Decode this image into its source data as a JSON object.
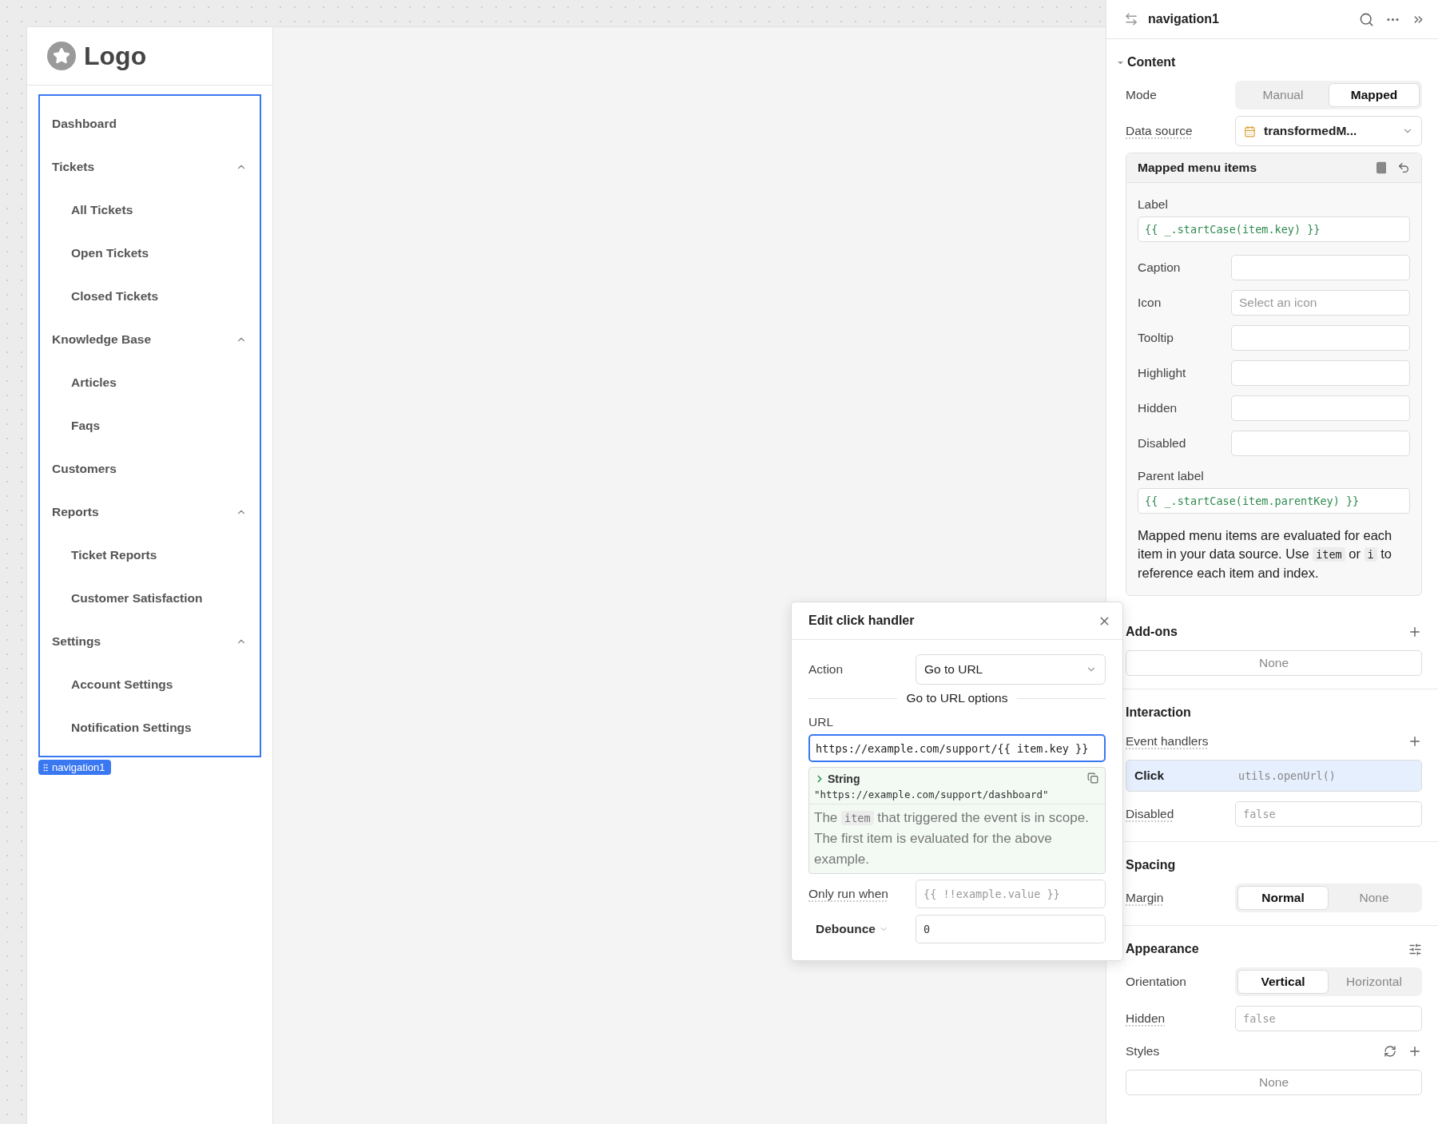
{
  "nav": {
    "logo": "Logo",
    "tag": "navigation1",
    "items": [
      {
        "label": "Dashboard"
      },
      {
        "label": "Tickets",
        "expanded": true,
        "children": [
          {
            "label": "All Tickets"
          },
          {
            "label": "Open Tickets"
          },
          {
            "label": "Closed Tickets"
          }
        ]
      },
      {
        "label": "Knowledge Base",
        "expanded": true,
        "children": [
          {
            "label": "Articles"
          },
          {
            "label": "Faqs"
          }
        ]
      },
      {
        "label": "Customers"
      },
      {
        "label": "Reports",
        "expanded": true,
        "children": [
          {
            "label": "Ticket Reports"
          },
          {
            "label": "Customer Satisfaction"
          }
        ]
      },
      {
        "label": "Settings",
        "expanded": true,
        "children": [
          {
            "label": "Account Settings"
          },
          {
            "label": "Notification Settings"
          }
        ]
      }
    ]
  },
  "inspector": {
    "title": "navigation1",
    "content": {
      "title": "Content",
      "expanded": true,
      "mode": {
        "label": "Mode",
        "options": [
          {
            "label": "Manual",
            "selected": false
          },
          {
            "label": "Mapped",
            "selected": true
          }
        ]
      },
      "data_source": {
        "label": "Data source",
        "value": "transformedM..."
      },
      "mapped": {
        "title": "Mapped menu items",
        "label": {
          "label": "Label",
          "value": "{{ _.startCase(item.key) }}"
        },
        "fields": [
          {
            "label": "Caption"
          },
          {
            "label": "Icon",
            "placeholder": "Select an icon"
          },
          {
            "label": "Tooltip"
          },
          {
            "label": "Highlight"
          },
          {
            "label": "Hidden"
          },
          {
            "label": "Disabled"
          }
        ],
        "parent_label": {
          "label": "Parent label",
          "value": "{{ _.startCase(item.parentKey) }}"
        },
        "note": [
          {
            "kind": "text",
            "text": "Mapped menu items are evaluated for each item in your data source. Use "
          },
          {
            "kind": "code",
            "text": "item"
          },
          {
            "kind": "text",
            "text": " or "
          },
          {
            "kind": "code",
            "text": "i"
          },
          {
            "kind": "text",
            "text": " to reference each item and index."
          }
        ]
      }
    },
    "addons": {
      "title": "Add-ons",
      "value": "None"
    },
    "interaction": {
      "title": "Interaction",
      "event_handlers": {
        "label": "Event handlers",
        "items": [
          {
            "event": "Click",
            "action": "utils.openUrl()",
            "selected": true
          }
        ]
      },
      "disabled": {
        "label": "Disabled",
        "placeholder": "false"
      }
    },
    "spacing": {
      "title": "Spacing",
      "margin": {
        "label": "Margin",
        "options": [
          {
            "label": "Normal",
            "selected": true
          },
          {
            "label": "None",
            "selected": false
          }
        ]
      }
    },
    "appearance": {
      "title": "Appearance",
      "orientation": {
        "label": "Orientation",
        "options": [
          {
            "label": "Vertical",
            "selected": true
          },
          {
            "label": "Horizontal",
            "selected": false
          }
        ]
      },
      "hidden": {
        "label": "Hidden",
        "placeholder": "false"
      },
      "styles": {
        "label": "Styles",
        "value": "None"
      }
    }
  },
  "modal": {
    "title": "Edit click handler",
    "action": {
      "label": "Action",
      "value": "Go to URL"
    },
    "options_heading": "Go to URL options",
    "url": {
      "label": "URL",
      "value": "https://example.com/support/{{ item.key }}"
    },
    "preview": {
      "type": "String",
      "value": "\"https://example.com/support/dashboard\"",
      "note": [
        {
          "kind": "text",
          "text": "The "
        },
        {
          "kind": "code",
          "text": "item"
        },
        {
          "kind": "text",
          "text": " that triggered the event is in scope. The first item is evaluated for the above example."
        }
      ]
    },
    "only_run_when": {
      "label": "Only run when",
      "placeholder": "{{ !!example.value }}"
    },
    "debounce": {
      "label": "Debounce",
      "value": "0"
    }
  }
}
